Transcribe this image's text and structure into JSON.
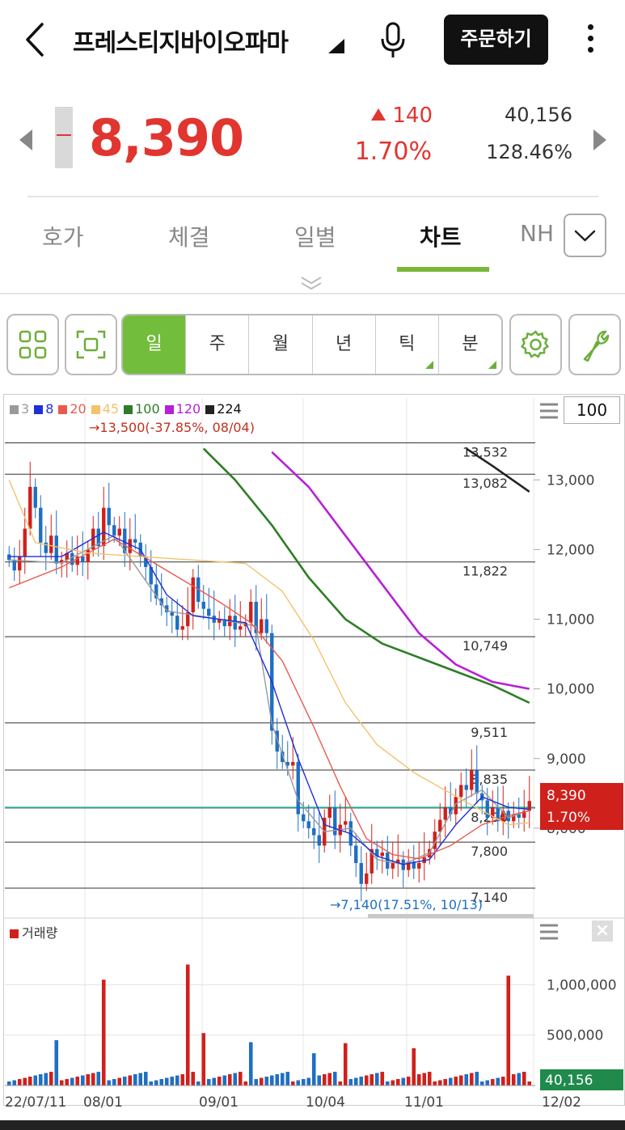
{
  "header": {
    "stock_name": "프레스티지바이오파마",
    "order_label": "주문하기"
  },
  "quote": {
    "price": "8,390",
    "change": "140",
    "change_pct": "1.70%",
    "volume": "40,156",
    "volume_rate": "128.46%"
  },
  "tabs": [
    {
      "label": "호가"
    },
    {
      "label": "체결"
    },
    {
      "label": "일별"
    },
    {
      "label": "차트"
    },
    {
      "label": "NH"
    }
  ],
  "active_tab": "차트",
  "periods": [
    {
      "label": "일"
    },
    {
      "label": "주"
    },
    {
      "label": "월"
    },
    {
      "label": "년"
    },
    {
      "label": "틱"
    },
    {
      "label": "분"
    }
  ],
  "active_period": "일",
  "chart_legend": [
    {
      "label": "3",
      "color": "#9a9a9a"
    },
    {
      "label": "8",
      "color": "#1f2fd6"
    },
    {
      "label": "20",
      "color": "#e85a4f"
    },
    {
      "label": "45",
      "color": "#f3c26b"
    },
    {
      "label": "100",
      "color": "#2e7d26"
    },
    {
      "label": "120",
      "color": "#b81fd8"
    },
    {
      "label": "224",
      "color": "#222222"
    }
  ],
  "period_count": "100",
  "volume_label": "거래량",
  "chart_data": {
    "type": "candlestick",
    "price_axis": {
      "ylim": [
        7000,
        13700
      ],
      "ticks": [
        8000,
        9000,
        10000,
        11000,
        12000,
        13000
      ],
      "tick_labels": [
        "8,000",
        "9,000",
        "10,000",
        "11,000",
        "12,000",
        "13,000"
      ]
    },
    "volume_axis": {
      "ylim": [
        0,
        1300000
      ],
      "ticks": [
        500000,
        1000000
      ],
      "tick_labels": [
        "500,000",
        "1,000,000"
      ]
    },
    "x_labels": [
      "22/07/11",
      "08/01",
      "09/01",
      "10/04",
      "11/01",
      "12/02"
    ],
    "level_lines": [
      {
        "value": 13532,
        "label": "13,532"
      },
      {
        "value": 13082,
        "label": "13,082"
      },
      {
        "value": 11822,
        "label": "11,822"
      },
      {
        "value": 10749,
        "label": "10,749"
      },
      {
        "value": 9511,
        "label": "9,511"
      },
      {
        "value": 8835,
        "label": "8,835"
      },
      {
        "value": 8290,
        "label": "8,290"
      },
      {
        "value": 7800,
        "label": "7,800"
      },
      {
        "value": 7140,
        "label": "7,140"
      }
    ],
    "high_annotation": "13,500(-37.85%, 08/04)",
    "low_annotation": "7,140(17.51%, 10/13)",
    "current_price_label": "8,390",
    "current_pct_label": "1.70%",
    "current_volume_label": "40,156",
    "closes": [
      11850,
      11700,
      11900,
      12300,
      12900,
      12600,
      12100,
      11950,
      12200,
      11800,
      11850,
      11950,
      11780,
      11900,
      11820,
      12000,
      12300,
      12050,
      12600,
      12350,
      12200,
      12300,
      11950,
      12150,
      12100,
      11900,
      11750,
      11500,
      11300,
      11200,
      11100,
      11050,
      10850,
      10900,
      11100,
      11600,
      11250,
      11150,
      11050,
      10950,
      11000,
      10900,
      11050,
      10850,
      10900,
      10950,
      11250,
      10800,
      11000,
      10800,
      9400,
      9100,
      8950,
      8900,
      8950,
      8200,
      8100,
      8000,
      7900,
      7750,
      8150,
      8300,
      7900,
      8050,
      8100,
      7750,
      7500,
      7200,
      7350,
      7700,
      7600,
      7650,
      7420,
      7500,
      7550,
      7400,
      7520,
      7420,
      7500,
      7580,
      7700,
      7950,
      8120,
      8300,
      8200,
      8450,
      8620,
      8550,
      8830,
      8500,
      8400,
      8150,
      8300,
      8100,
      8250,
      8100,
      8200,
      8150,
      8250,
      8390
    ],
    "ma": [
      {
        "name": "3",
        "values": [
          [
            0,
            11850
          ],
          [
            10,
            11810
          ],
          [
            20,
            12200
          ],
          [
            30,
            11120
          ],
          [
            40,
            11000
          ],
          [
            47,
            10900
          ],
          [
            50,
            9500
          ],
          [
            55,
            8400
          ],
          [
            60,
            7950
          ],
          [
            65,
            8000
          ],
          [
            70,
            7550
          ],
          [
            75,
            7480
          ],
          [
            80,
            7650
          ],
          [
            85,
            8350
          ],
          [
            90,
            8550
          ],
          [
            95,
            8150
          ],
          [
            99,
            8260
          ]
        ]
      },
      {
        "name": "8",
        "values": [
          [
            0,
            11900
          ],
          [
            10,
            11900
          ],
          [
            18,
            12250
          ],
          [
            25,
            12000
          ],
          [
            30,
            11350
          ],
          [
            35,
            11050
          ],
          [
            45,
            10950
          ],
          [
            50,
            10100
          ],
          [
            55,
            9000
          ],
          [
            60,
            8050
          ],
          [
            65,
            7920
          ],
          [
            70,
            7600
          ],
          [
            75,
            7480
          ],
          [
            80,
            7550
          ],
          [
            85,
            8050
          ],
          [
            90,
            8450
          ],
          [
            95,
            8300
          ],
          [
            99,
            8270
          ]
        ]
      },
      {
        "name": "20",
        "values": [
          [
            0,
            11450
          ],
          [
            10,
            11750
          ],
          [
            20,
            12150
          ],
          [
            30,
            11700
          ],
          [
            40,
            11250
          ],
          [
            46,
            10950
          ],
          [
            52,
            10400
          ],
          [
            58,
            9450
          ],
          [
            63,
            8600
          ],
          [
            68,
            7850
          ],
          [
            73,
            7620
          ],
          [
            78,
            7560
          ],
          [
            84,
            7750
          ],
          [
            90,
            8050
          ],
          [
            95,
            8180
          ],
          [
            99,
            8250
          ]
        ]
      },
      {
        "name": "45",
        "values": [
          [
            0,
            13000
          ],
          [
            5,
            12100
          ],
          [
            15,
            11950
          ],
          [
            25,
            11900
          ],
          [
            35,
            11850
          ],
          [
            45,
            11800
          ],
          [
            52,
            11400
          ],
          [
            58,
            10700
          ],
          [
            64,
            9800
          ],
          [
            70,
            9200
          ],
          [
            77,
            8800
          ],
          [
            84,
            8500
          ],
          [
            90,
            8250
          ],
          [
            95,
            8050
          ],
          [
            99,
            8080
          ]
        ]
      },
      {
        "name": "100",
        "values": [
          [
            37,
            13450
          ],
          [
            43,
            13000
          ],
          [
            50,
            12350
          ],
          [
            57,
            11600
          ],
          [
            64,
            11000
          ],
          [
            71,
            10650
          ],
          [
            78,
            10450
          ],
          [
            85,
            10250
          ],
          [
            92,
            10050
          ],
          [
            99,
            9800
          ]
        ]
      },
      {
        "name": "120",
        "values": [
          [
            50,
            13400
          ],
          [
            57,
            12900
          ],
          [
            64,
            12200
          ],
          [
            71,
            11500
          ],
          [
            78,
            10800
          ],
          [
            85,
            10350
          ],
          [
            92,
            10100
          ],
          [
            99,
            10000
          ]
        ]
      },
      {
        "name": "224",
        "values": [
          [
            87,
            13450
          ],
          [
            92,
            13200
          ],
          [
            99,
            12830
          ]
        ]
      }
    ],
    "volume_spikes": [
      [
        9,
        450000,
        "up"
      ],
      [
        18,
        1050000,
        "down"
      ],
      [
        34,
        1200000,
        "down"
      ],
      [
        37,
        520000,
        "down"
      ],
      [
        46,
        430000,
        "up"
      ],
      [
        58,
        320000,
        "up"
      ],
      [
        64,
        420000,
        "down"
      ],
      [
        77,
        370000,
        "down"
      ],
      [
        95,
        1090000,
        "down"
      ]
    ]
  }
}
